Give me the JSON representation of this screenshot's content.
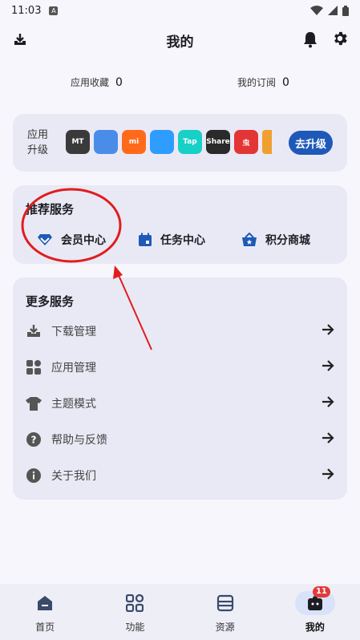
{
  "status_bar": {
    "time": "11:03",
    "notif_letter": "A"
  },
  "header": {
    "title": "我的"
  },
  "stats": {
    "apps_label": "应用收藏",
    "apps_count": "0",
    "subs_label": "我的订阅",
    "subs_count": "0"
  },
  "upgrade": {
    "label_line1": "应用",
    "label_line2": "升级",
    "button_label": "去升级",
    "icons": [
      {
        "name": "mt-manager-icon",
        "text": "MT",
        "color": "#3a3a3a"
      },
      {
        "name": "app-icon-2",
        "text": "",
        "color": "#4a8de8"
      },
      {
        "name": "mi-store-icon",
        "text": "mi",
        "color": "#ff6a1a"
      },
      {
        "name": "browser-icon",
        "text": "",
        "color": "#2f9cff"
      },
      {
        "name": "taptap-icon",
        "text": "Tap",
        "color": "#17d1c6"
      },
      {
        "name": "share-icon",
        "text": "Share",
        "color": "#2a2a2a"
      },
      {
        "name": "app-icon-7",
        "text": "虫",
        "color": "#e33535"
      },
      {
        "name": "app-icon-8",
        "text": "",
        "color": "#f0a030"
      }
    ]
  },
  "services": {
    "title": "推荐服务",
    "items": [
      {
        "label": "会员中心"
      },
      {
        "label": "任务中心"
      },
      {
        "label": "积分商城"
      }
    ]
  },
  "more": {
    "title": "更多服务",
    "items": [
      {
        "label": "下载管理"
      },
      {
        "label": "应用管理"
      },
      {
        "label": "主题模式"
      },
      {
        "label": "帮助与反馈"
      },
      {
        "label": "关于我们"
      }
    ]
  },
  "nav": {
    "items": [
      {
        "label": "首页"
      },
      {
        "label": "功能"
      },
      {
        "label": "资源"
      },
      {
        "label": "我的"
      }
    ],
    "badge": "11"
  },
  "colors": {
    "accent": "#1f59b8",
    "annotation": "#e11d1d",
    "card_bg": "#e9e9f5"
  }
}
